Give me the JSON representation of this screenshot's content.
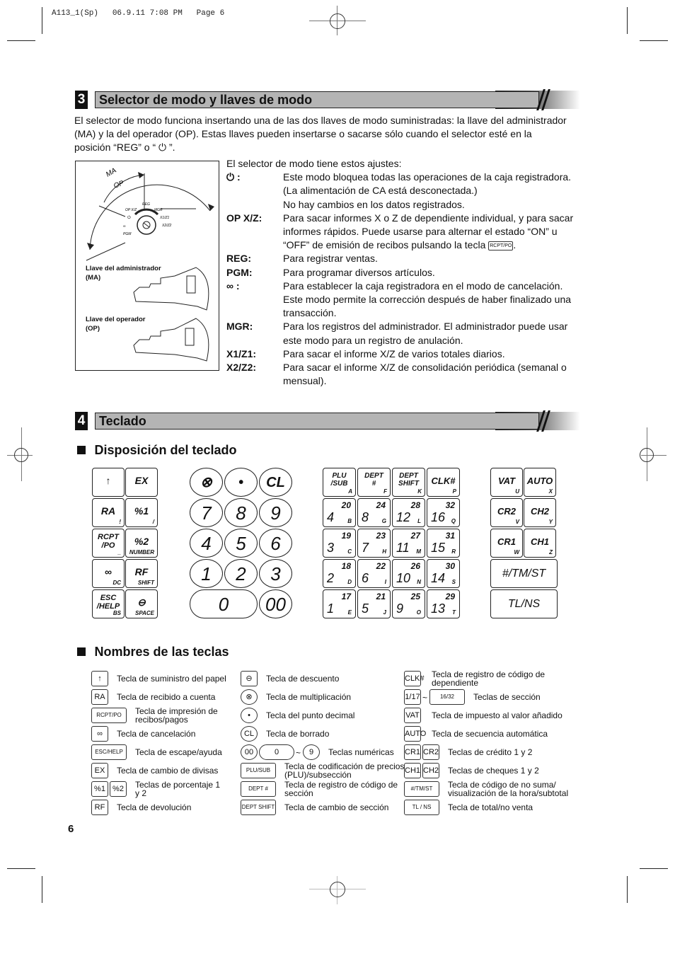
{
  "slug": "A113_1(Sp)   06.9.11 7:08 PM   Page 6",
  "section3": {
    "number": "3",
    "title": "Selector de modo y llaves de modo",
    "intro": [
      "El selector de modo funciona insertando una de las dos llaves de modo suministradas: la llave del administrador",
      "(MA) y la del operador (OP). Estas llaves pueden insertarse o sacarse sólo cuando el selector esté en la",
      "posición “REG” o “ ⏻ ”."
    ],
    "diagram": {
      "arc_labels": [
        "MA",
        "OP"
      ],
      "positions": [
        "OP X/Z",
        "REG",
        "MGR",
        "⏻",
        "X1/Z1",
        "∞",
        "X2/Z2",
        "PGM"
      ],
      "key_ma_label": "Llave del administrador",
      "key_ma_abbr": "(MA)",
      "key_ma_tag": "MA",
      "key_op_label": "Llave del operador",
      "key_op_abbr": "(OP)",
      "key_op_tag": "OP"
    },
    "settings_intro": "El selector de modo tiene estos ajustes:",
    "settings": [
      {
        "key": "⏻ :",
        "lines": [
          "Este modo bloquea todas las operaciones de la caja registradora.",
          "(La alimentación de CA está desconectada.)",
          "No hay cambios en los datos registrados."
        ]
      },
      {
        "key": "OP X/Z:",
        "lines": [
          "Para sacar informes X o Z de dependiente individual, y para sacar",
          "informes rápidos. Puede usarse para alternar el estado “ON” u",
          "“OFF” de emisión de recibos pulsando la tecla"
        ]
      },
      {
        "key": "REG:",
        "lines": [
          "Para registrar ventas."
        ]
      },
      {
        "key": "PGM:",
        "lines": [
          "Para programar diversos artículos."
        ]
      },
      {
        "key": "∞ :",
        "lines": [
          "Para establecer la caja registradora en el modo de cancelación.",
          "Este modo permite la corrección después de haber finalizado una",
          "transacción."
        ]
      },
      {
        "key": "MGR:",
        "lines": [
          "Para los registros del administrador. El administrador puede usar",
          "este modo para un registro de anulación."
        ]
      },
      {
        "key": "X1/Z1:",
        "lines": [
          "Para sacar el informe X/Z de varios totales diarios."
        ]
      },
      {
        "key": "X2/Z2:",
        "lines": [
          "Para sacar el informe X/Z de consolidación periódica (semanal o",
          "mensual)."
        ]
      }
    ],
    "rcpt_inline_key": "RCPT/PO"
  },
  "section4": {
    "number": "4",
    "title": "Teclado",
    "layout_heading": "Disposición del teclado",
    "names_heading": "Nombres de las teclas",
    "left_keys": [
      {
        "main": "↑",
        "sub": ""
      },
      {
        "main": "EX",
        "sub": ""
      },
      {
        "main": "RA",
        "sub": "!"
      },
      {
        "main": "%1",
        "sub": "/"
      },
      {
        "main": "RCPT\n/PO",
        "sub": "_"
      },
      {
        "main": "%2",
        "sub": "NUMBER"
      },
      {
        "main": "∞",
        "sub": "DC"
      },
      {
        "main": "RF",
        "sub": "SHIFT"
      },
      {
        "main": "ESC\n/HELP",
        "sub": "BS"
      },
      {
        "main": "⊖",
        "sub": "SPACE"
      }
    ],
    "numpad": [
      "⊗",
      "•",
      "CL",
      "7",
      "8",
      "9",
      "4",
      "5",
      "6",
      "1",
      "2",
      "3",
      "0",
      "00"
    ],
    "func_top": [
      {
        "main": "PLU\n/SUB",
        "sub": "A"
      },
      {
        "main": "DEPT\n#",
        "sub": "F"
      },
      {
        "main": "DEPT\nSHIFT",
        "sub": "K"
      },
      {
        "main": "CLK#",
        "sub": "P"
      }
    ],
    "dept_keys": [
      {
        "top": "20",
        "big": "4",
        "sub": "B"
      },
      {
        "top": "24",
        "big": "8",
        "sub": "G"
      },
      {
        "top": "28",
        "big": "12",
        "sub": "L"
      },
      {
        "top": "32",
        "big": "16",
        "sub": "Q"
      },
      {
        "top": "19",
        "big": "3",
        "sub": "C"
      },
      {
        "top": "23",
        "big": "7",
        "sub": "H"
      },
      {
        "top": "27",
        "big": "11",
        "sub": "M"
      },
      {
        "top": "31",
        "big": "15",
        "sub": "R"
      },
      {
        "top": "18",
        "big": "2",
        "sub": "D"
      },
      {
        "top": "22",
        "big": "6",
        "sub": "I"
      },
      {
        "top": "26",
        "big": "10",
        "sub": "N"
      },
      {
        "top": "30",
        "big": "14",
        "sub": "S"
      },
      {
        "top": "17",
        "big": "1",
        "sub": "E"
      },
      {
        "top": "21",
        "big": "5",
        "sub": "J"
      },
      {
        "top": "25",
        "big": "9",
        "sub": "O"
      },
      {
        "top": "29",
        "big": "13",
        "sub": "T"
      }
    ],
    "right_keys": [
      {
        "main": "VAT",
        "sub": "U"
      },
      {
        "main": "AUTO",
        "sub": "X"
      },
      {
        "main": "CR2",
        "sub": "V"
      },
      {
        "main": "CH2",
        "sub": "Y"
      },
      {
        "main": "CR1",
        "sub": "W"
      },
      {
        "main": "CH1",
        "sub": "Z"
      }
    ],
    "wide_keys": [
      "#/TM/ST",
      "TL/NS"
    ],
    "names_col1": [
      {
        "icons": [
          "↑"
        ],
        "text": "Tecla de suministro del papel"
      },
      {
        "icons": [
          "RA"
        ],
        "text": "Tecla de recibido a cuenta"
      },
      {
        "icons": [
          "RCPT/PO"
        ],
        "text": "Tecla de impresión de\nrecibos/pagos"
      },
      {
        "icons": [
          "∞"
        ],
        "text": "Tecla de cancelación"
      },
      {
        "icons": [
          "ESC/HELP"
        ],
        "text": "Tecla de escape/ayuda"
      },
      {
        "icons": [
          "EX"
        ],
        "text": "Tecla de cambio de divisas"
      },
      {
        "icons": [
          "%1",
          "%2"
        ],
        "text": "Teclas de porcentaje 1\ny 2"
      },
      {
        "icons": [
          "RF"
        ],
        "text": "Tecla de devolución"
      }
    ],
    "names_col2": [
      {
        "icons": [
          "⊖"
        ],
        "text": "Tecla de descuento"
      },
      {
        "icons": [
          "⊗"
        ],
        "text": "Tecla de multiplicación"
      },
      {
        "icons": [
          "•"
        ],
        "text": "Tecla del punto decimal"
      },
      {
        "icons": [
          "CL"
        ],
        "text": "Tecla de borrado"
      },
      {
        "icons": [
          "00",
          "0",
          "~",
          "9"
        ],
        "text": "Teclas numéricas"
      },
      {
        "icons": [
          "PLU/SUB"
        ],
        "text": "Tecla de codificación de precios\n(PLU)/subsección"
      },
      {
        "icons": [
          "DEPT #"
        ],
        "text": "Tecla de registro de código de\nsección"
      },
      {
        "icons": [
          "DEPT SHIFT"
        ],
        "text": "Tecla de cambio de sección"
      }
    ],
    "names_col3": [
      {
        "icons": [
          "CLK#"
        ],
        "text": "Tecla de registro de código de\ndependiente"
      },
      {
        "icons": [
          "1/17",
          "~",
          "16/32"
        ],
        "text": "Teclas de sección"
      },
      {
        "icons": [
          "VAT"
        ],
        "text": "Tecla de impuesto al valor añadido"
      },
      {
        "icons": [
          "AUTO"
        ],
        "text": "Tecla de secuencia automática"
      },
      {
        "icons": [
          "CR1",
          "CR2"
        ],
        "text": "Teclas de crédito 1 y 2"
      },
      {
        "icons": [
          "CH1",
          "CH2"
        ],
        "text": "Teclas de cheques 1 y 2"
      },
      {
        "icons": [
          "#/TM/ST"
        ],
        "text": "Tecla de código de no suma/\nvisualización de la hora/subtotal"
      },
      {
        "icons": [
          "TL / NS"
        ],
        "text": "Tecla de total/no venta"
      }
    ]
  },
  "page_number": "6"
}
